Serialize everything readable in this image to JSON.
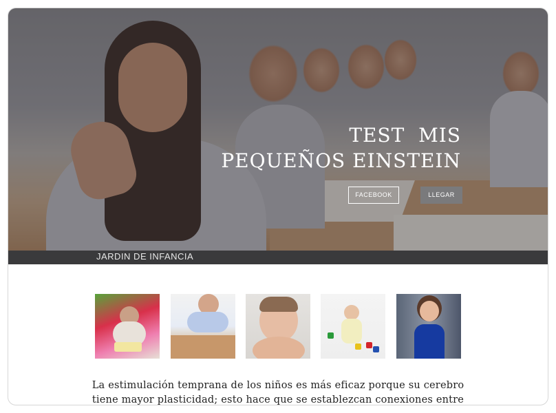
{
  "hero": {
    "title_line1": "TEST  MIS",
    "title_line2": "PEQUEÑOS EINSTEIN",
    "buttons": {
      "facebook": "FACEBOOK",
      "llegar": "LLEGAR"
    }
  },
  "strip": {
    "label": "JARDIN DE INFANCIA"
  },
  "gallery": {
    "thumbnails": [
      "photo-baby-playroom",
      "photo-child-painting",
      "photo-baby-face",
      "photo-baby-blocks",
      "photo-girl-blue-dress"
    ]
  },
  "intro": {
    "line1": "La estimulación temprana de los niños es más eficaz porque su cerebro",
    "line2": "tiene mayor plasticidad; esto hace que se establezcan conexiones entre"
  },
  "colors": {
    "overlay": "#28262a",
    "strip_bg": "#3a3a3c",
    "button_secondary": "#7a7a7c"
  }
}
